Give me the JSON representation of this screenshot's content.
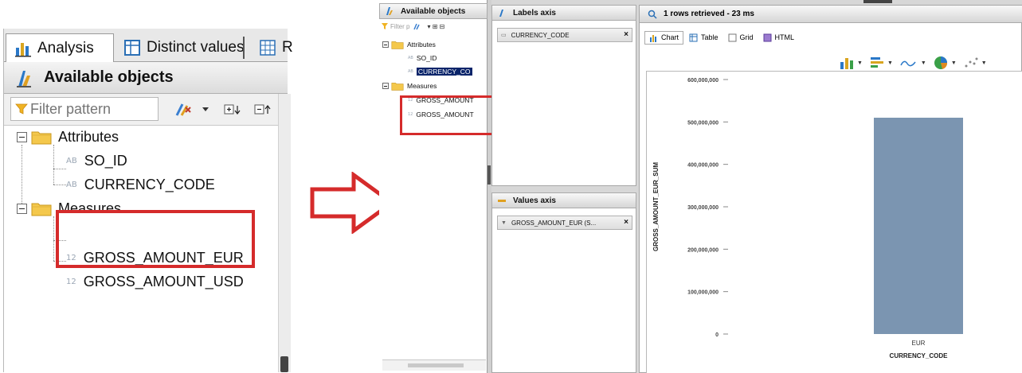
{
  "left_panel": {
    "tabs": [
      {
        "label": "Analysis",
        "active": true,
        "icon": "bar-chart-icon"
      },
      {
        "label": "Distinct values",
        "active": false,
        "icon": "table-icon"
      },
      {
        "label": "R",
        "active": false,
        "icon": "grid-icon"
      }
    ],
    "header": {
      "title": "Available objects",
      "icon": "objects-icon"
    },
    "filter": {
      "placeholder": "Filter pattern",
      "value": ""
    },
    "tree": {
      "attributes": {
        "label": "Attributes",
        "items": [
          {
            "tag": "AB",
            "label": "SO_ID"
          },
          {
            "tag": "AB",
            "label": "CURRENCY_CODE"
          }
        ]
      },
      "measures": {
        "label": "Measures",
        "items": [
          {
            "tag": "12",
            "label": "GROSS_AMOUNT_EUR"
          },
          {
            "tag": "12",
            "label": "GROSS_AMOUNT_USD"
          }
        ]
      }
    }
  },
  "right_app": {
    "available_objects": {
      "title": "Available objects",
      "filter_placeholder": "Filter p",
      "tree": {
        "attributes_label": "Attributes",
        "attribute_items": [
          {
            "tag": "AB",
            "label": "SO_ID"
          },
          {
            "tag": "AB",
            "label": "CURRENCY_CO"
          }
        ],
        "measures_label": "Measures",
        "measure_items": [
          {
            "tag": "12",
            "label": "GROSS_AMOUNT"
          },
          {
            "tag": "12",
            "label": "GROSS_AMOUNT"
          }
        ]
      }
    },
    "labels_axis": {
      "title": "Labels axis",
      "chip": "CURRENCY_CODE",
      "close": "×"
    },
    "values_axis": {
      "title": "Values axis",
      "chip": "GROSS_AMOUNT_EUR (S...",
      "close": "×"
    },
    "chart_panel": {
      "status": "1 rows retrieved - 23 ms",
      "tabs": [
        {
          "label": "Chart",
          "active": true
        },
        {
          "label": "Table",
          "active": false
        },
        {
          "label": "Grid",
          "active": false
        },
        {
          "label": "HTML",
          "active": false
        }
      ]
    }
  },
  "colors": {
    "highlight_red": "#d52b2b",
    "bar": "#7b95b1",
    "selection": "#0a246a"
  },
  "chart_data": {
    "type": "bar",
    "categories": [
      "EUR"
    ],
    "values": [
      510000000
    ],
    "ylabel": "GROSS_AMOUNT_EUR_SUM",
    "xlabel": "CURRENCY_CODE",
    "ylim": [
      0,
      600000000
    ],
    "yticks": [
      0,
      100000000,
      200000000,
      300000000,
      400000000,
      500000000,
      600000000
    ],
    "ytick_labels": [
      "0",
      "100,000,000",
      "200,000,000",
      "300,000,000",
      "400,000,000",
      "500,000,000",
      "600,000,000"
    ],
    "grid": false,
    "legend": "none"
  }
}
